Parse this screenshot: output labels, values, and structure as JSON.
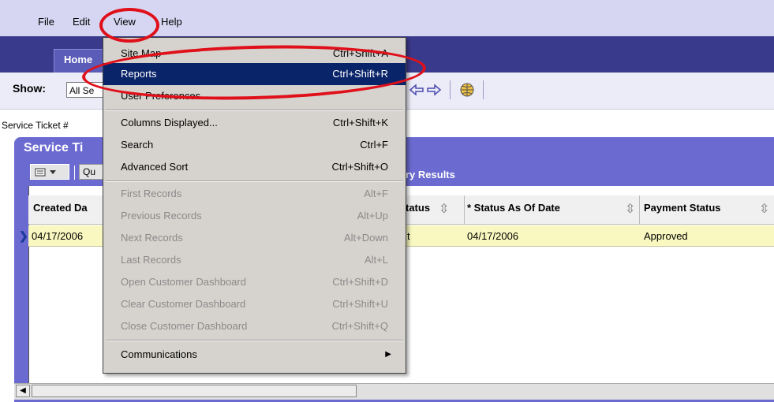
{
  "menubar": {
    "file": "File",
    "edit": "Edit",
    "view": "View",
    "help": "Help"
  },
  "nav": {
    "home_tab": "Home"
  },
  "toolbar": {
    "show_label": "Show:",
    "show_value": "All Se"
  },
  "ticket_line": "Service Ticket #",
  "panel": {
    "title": "Service Ti",
    "query_button": "Qu",
    "results_title": "ry Results"
  },
  "grid": {
    "headers": {
      "created_date": "Created Da",
      "status": "tatus",
      "status_as_of_date": "* Status As Of Date",
      "payment_status": "Payment Status"
    },
    "row": {
      "created_date": "04/17/2006",
      "status": "t",
      "status_as_of_date": "04/17/2006",
      "payment_status": "Approved"
    }
  },
  "view_menu": {
    "items": [
      {
        "label": "Site Map",
        "shortcut": "Ctrl+Shift+A",
        "enabled": true
      },
      {
        "label": "Reports",
        "shortcut": "Ctrl+Shift+R",
        "enabled": true,
        "highlighted": true
      },
      {
        "label": "User Preferences",
        "shortcut": "",
        "enabled": true
      },
      {
        "label": "Columns Displayed...",
        "shortcut": "Ctrl+Shift+K",
        "enabled": true
      },
      {
        "label": "Search",
        "shortcut": "Ctrl+F",
        "enabled": true
      },
      {
        "label": "Advanced Sort",
        "shortcut": "Ctrl+Shift+O",
        "enabled": true
      },
      {
        "label": "First Records",
        "shortcut": "Alt+F",
        "enabled": false
      },
      {
        "label": "Previous Records",
        "shortcut": "Alt+Up",
        "enabled": false
      },
      {
        "label": "Next Records",
        "shortcut": "Alt+Down",
        "enabled": false
      },
      {
        "label": "Last Records",
        "shortcut": "Alt+L",
        "enabled": false
      },
      {
        "label": "Open Customer Dashboard",
        "shortcut": "Ctrl+Shift+D",
        "enabled": false
      },
      {
        "label": "Clear Customer Dashboard",
        "shortcut": "Ctrl+Shift+U",
        "enabled": false
      },
      {
        "label": "Close Customer Dashboard",
        "shortcut": "Ctrl+Shift+Q",
        "enabled": false
      },
      {
        "label": "Communications",
        "shortcut": "",
        "enabled": true,
        "submenu": true
      }
    ]
  },
  "icons": {
    "menu_button": "list-menu-icon",
    "back": "back-arrow-icon",
    "forward": "forward-arrow-icon",
    "globe": "globe-icon",
    "row_pointer": "row-pointer-icon",
    "sort": "sort-arrows-icon",
    "submenu": "submenu-arrow-icon"
  },
  "colors": {
    "highlight": "#0a246a",
    "annotation": "#e0101a",
    "panel": "#6a6ad0",
    "row_selected": "#f8f8c0"
  }
}
